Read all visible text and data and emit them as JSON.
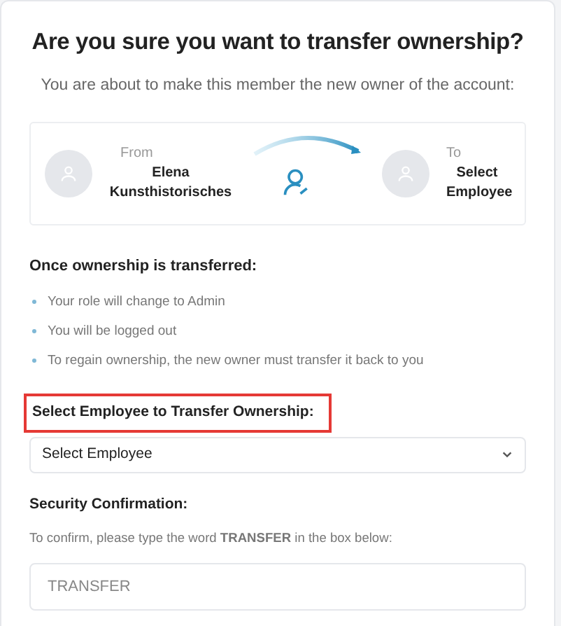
{
  "title": "Are you sure you want to transfer ownership?",
  "subtitle": "You are about to make this member the new owner of the account:",
  "transfer": {
    "from": {
      "label": "From",
      "name": "Elena Kunsthistorisches"
    },
    "to": {
      "label": "To",
      "name": "Select Employee"
    }
  },
  "consequences": {
    "heading": "Once ownership is transferred:",
    "items": [
      "Your role will change to Admin",
      "You will be logged out",
      "To regain ownership, the new owner must transfer it back to you"
    ]
  },
  "employee_select": {
    "label": "Select Employee to Transfer Ownership:",
    "highlighted": true,
    "value": "Select Employee"
  },
  "security": {
    "heading": "Security Confirmation:",
    "instruction": "To confirm, please type the word **TRANSFER** in the box below:",
    "placeholder": "TRANSFER"
  }
}
